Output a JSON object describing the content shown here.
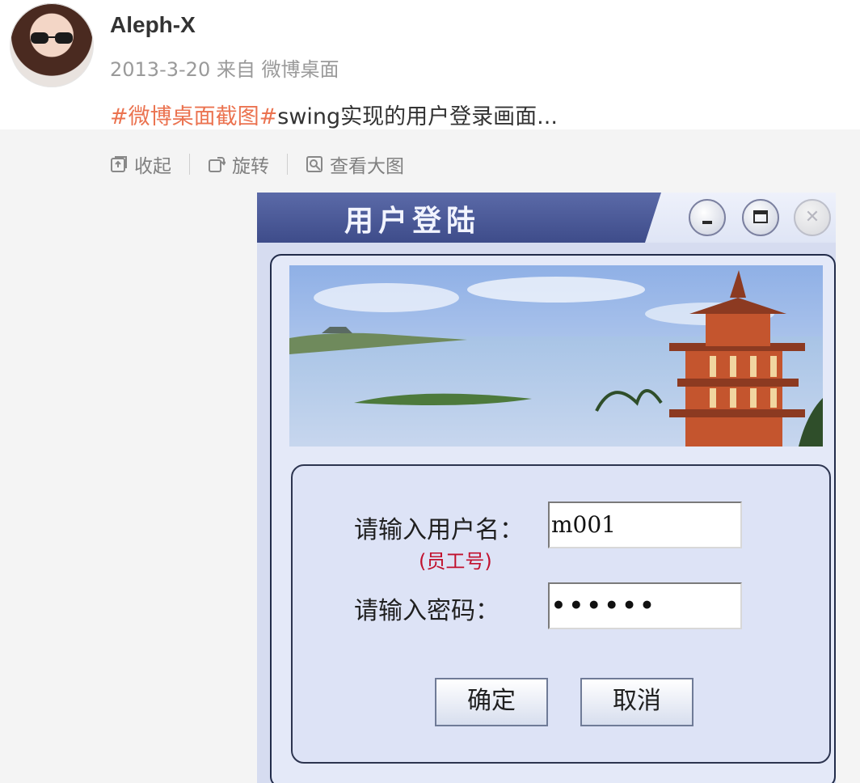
{
  "post": {
    "username": "Aleph-X",
    "meta": "2013-3-20 来自 微博桌面",
    "topic": "#微博桌面截图#",
    "text": "swing实现的用户登录画面..."
  },
  "toolbar": {
    "collapse": "收起",
    "rotate": "旋转",
    "view_large": "查看大图"
  },
  "login_window": {
    "title": "用户登陆",
    "username_label": "请输入用户名：",
    "username_hint": "(员工号)",
    "username_value": "m001",
    "password_label": "请输入密码：",
    "password_value": "••••••",
    "ok_button": "确定",
    "cancel_button": "取消"
  },
  "colors": {
    "topic": "#eb7350",
    "title_bar": "#3e4c8a",
    "hint": "#c1112e"
  },
  "icons": {
    "collapse": "collapse-icon",
    "rotate": "rotate-icon",
    "view_large": "view-large-icon",
    "minimize": "minimize-icon",
    "maximize": "maximize-icon",
    "close": "close-icon"
  }
}
